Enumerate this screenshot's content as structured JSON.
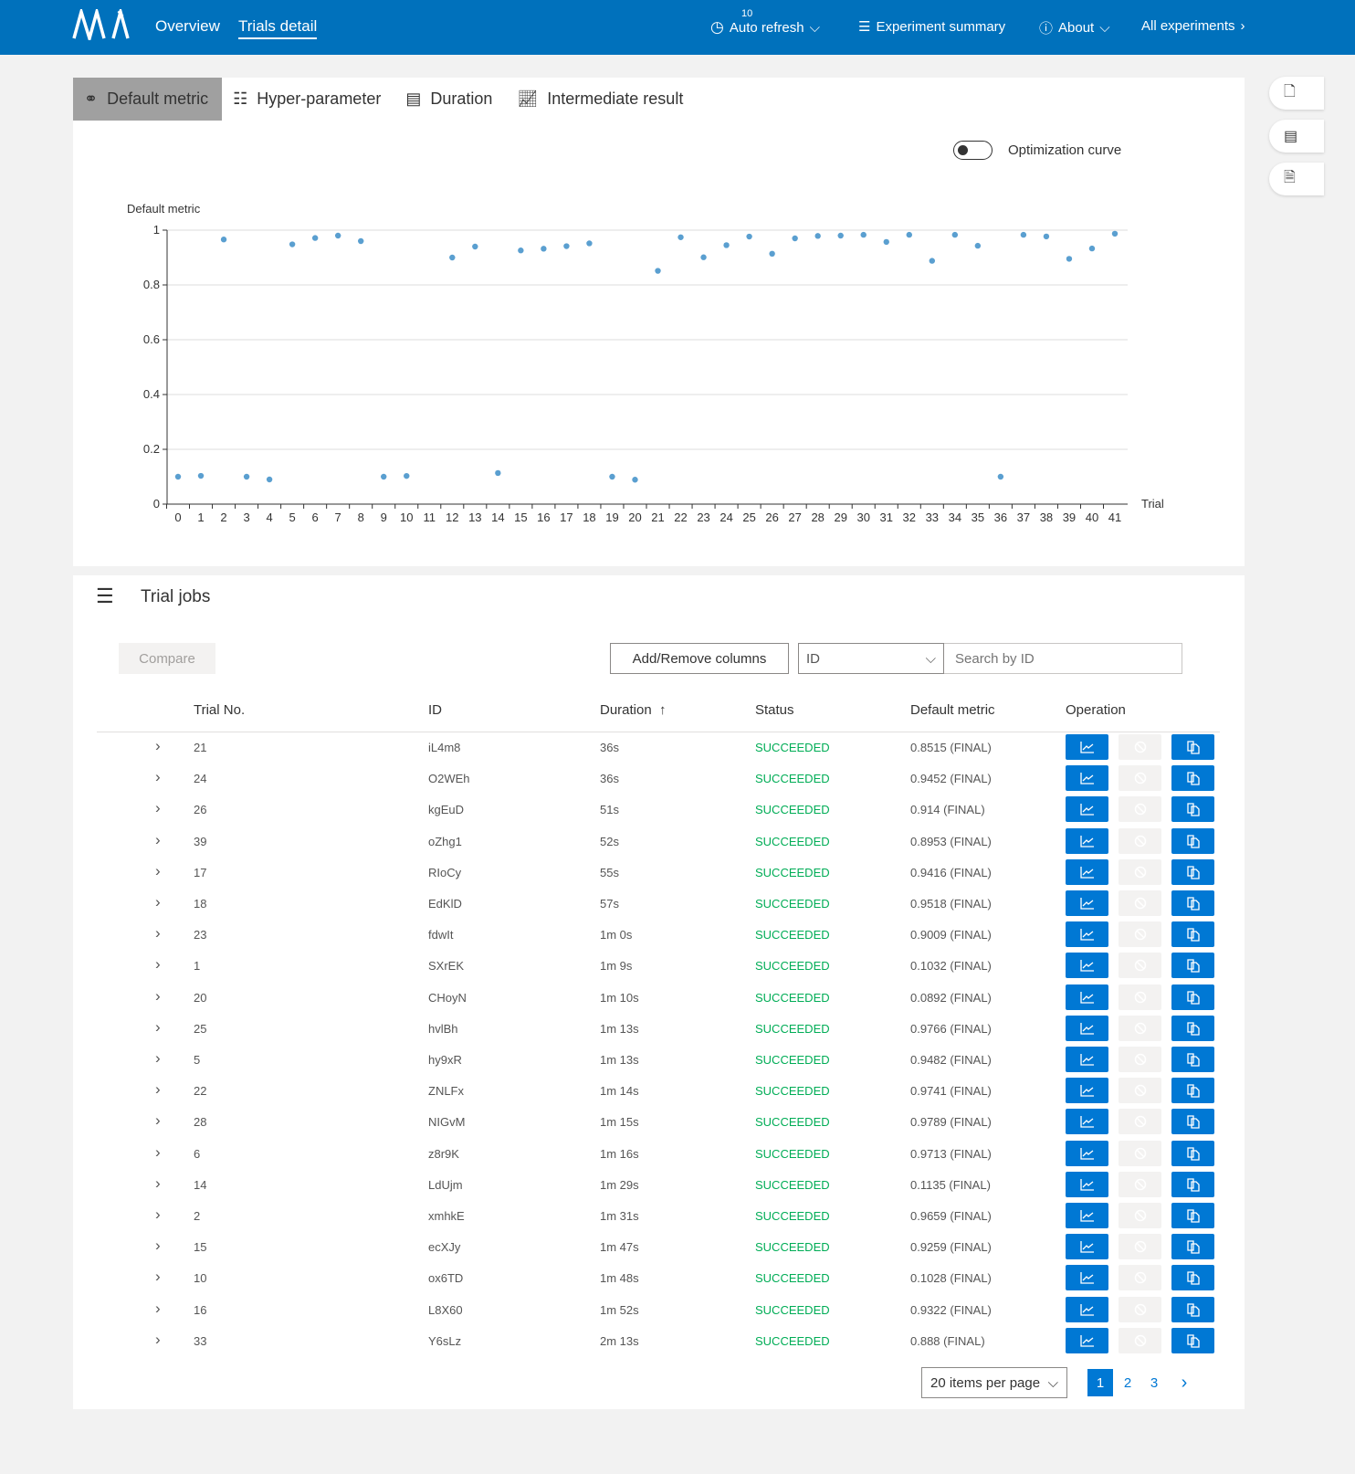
{
  "header": {
    "logo": "NNI",
    "nav": [
      "Overview",
      "Trials detail"
    ],
    "auto_refresh": "Auto refresh",
    "refresh_interval": "10",
    "experiment_summary": "Experiment summary",
    "about": "About",
    "all_experiments": "All experiments"
  },
  "tabs": [
    "Default metric",
    "Hyper-parameter",
    "Duration",
    "Intermediate result"
  ],
  "optimization_curve": "Optimization curve",
  "chart_data": {
    "type": "scatter",
    "ylabel": "Default metric",
    "xlabel": "Trial",
    "ylim": [
      0,
      1
    ],
    "yticks": [
      "0",
      "0.2",
      "0.4",
      "0.6",
      "0.8",
      "1"
    ],
    "xticks": [
      "0",
      "1",
      "2",
      "3",
      "4",
      "5",
      "6",
      "7",
      "8",
      "9",
      "10",
      "11",
      "12",
      "13",
      "14",
      "15",
      "16",
      "17",
      "18",
      "19",
      "20",
      "21",
      "22",
      "23",
      "24",
      "25",
      "26",
      "27",
      "28",
      "29",
      "30",
      "31",
      "32",
      "33",
      "34",
      "35",
      "36",
      "37",
      "38",
      "39",
      "40",
      "41"
    ],
    "grid": true,
    "color": "#5a9fd0",
    "points": [
      [
        0,
        0.1
      ],
      [
        1,
        0.1032
      ],
      [
        2,
        0.9659
      ],
      [
        3,
        0.1
      ],
      [
        4,
        0.09
      ],
      [
        5,
        0.9482
      ],
      [
        6,
        0.9713
      ],
      [
        7,
        0.98
      ],
      [
        8,
        0.96
      ],
      [
        9,
        0.1
      ],
      [
        10,
        0.1028
      ],
      [
        12,
        0.9
      ],
      [
        13,
        0.94
      ],
      [
        14,
        0.1135
      ],
      [
        15,
        0.9259
      ],
      [
        16,
        0.9322
      ],
      [
        17,
        0.9416
      ],
      [
        18,
        0.9518
      ],
      [
        19,
        0.1
      ],
      [
        20,
        0.0892
      ],
      [
        21,
        0.8515
      ],
      [
        22,
        0.9741
      ],
      [
        23,
        0.9009
      ],
      [
        24,
        0.9452
      ],
      [
        25,
        0.9766
      ],
      [
        26,
        0.914
      ],
      [
        27,
        0.97
      ],
      [
        28,
        0.9789
      ],
      [
        29,
        0.98
      ],
      [
        30,
        0.983
      ],
      [
        31,
        0.957
      ],
      [
        32,
        0.983
      ],
      [
        33,
        0.888
      ],
      [
        34,
        0.983
      ],
      [
        35,
        0.943
      ],
      [
        36,
        0.1
      ],
      [
        37,
        0.983
      ],
      [
        38,
        0.977
      ],
      [
        39,
        0.8953
      ],
      [
        40,
        0.933
      ],
      [
        41,
        0.987
      ]
    ]
  },
  "trial_jobs": {
    "title": "Trial jobs",
    "compare": "Compare",
    "add_remove": "Add/Remove columns",
    "filter_select": "ID",
    "search_placeholder": "Search by ID",
    "columns": [
      "Trial No.",
      "ID",
      "Duration",
      "Status",
      "Default metric",
      "Operation"
    ],
    "sort_indicator": "↑",
    "rows": [
      [
        "21",
        "iL4m8",
        "36s",
        "SUCCEEDED",
        "0.8515 (FINAL)"
      ],
      [
        "24",
        "O2WEh",
        "36s",
        "SUCCEEDED",
        "0.9452 (FINAL)"
      ],
      [
        "26",
        "kgEuD",
        "51s",
        "SUCCEEDED",
        "0.914 (FINAL)"
      ],
      [
        "39",
        "oZhg1",
        "52s",
        "SUCCEEDED",
        "0.8953 (FINAL)"
      ],
      [
        "17",
        "RIoCy",
        "55s",
        "SUCCEEDED",
        "0.9416 (FINAL)"
      ],
      [
        "18",
        "EdKlD",
        "57s",
        "SUCCEEDED",
        "0.9518 (FINAL)"
      ],
      [
        "23",
        "fdwIt",
        "1m 0s",
        "SUCCEEDED",
        "0.9009 (FINAL)"
      ],
      [
        "1",
        "SXrEK",
        "1m 9s",
        "SUCCEEDED",
        "0.1032 (FINAL)"
      ],
      [
        "20",
        "CHoyN",
        "1m 10s",
        "SUCCEEDED",
        "0.0892 (FINAL)"
      ],
      [
        "25",
        "hvlBh",
        "1m 13s",
        "SUCCEEDED",
        "0.9766 (FINAL)"
      ],
      [
        "5",
        "hy9xR",
        "1m 13s",
        "SUCCEEDED",
        "0.9482 (FINAL)"
      ],
      [
        "22",
        "ZNLFx",
        "1m 14s",
        "SUCCEEDED",
        "0.9741 (FINAL)"
      ],
      [
        "28",
        "NIGvM",
        "1m 15s",
        "SUCCEEDED",
        "0.9789 (FINAL)"
      ],
      [
        "6",
        "z8r9K",
        "1m 16s",
        "SUCCEEDED",
        "0.9713 (FINAL)"
      ],
      [
        "14",
        "LdUjm",
        "1m 29s",
        "SUCCEEDED",
        "0.1135 (FINAL)"
      ],
      [
        "2",
        "xmhkE",
        "1m 31s",
        "SUCCEEDED",
        "0.9659 (FINAL)"
      ],
      [
        "15",
        "ecXJy",
        "1m 47s",
        "SUCCEEDED",
        "0.9259 (FINAL)"
      ],
      [
        "10",
        "ox6TD",
        "1m 48s",
        "SUCCEEDED",
        "0.1028 (FINAL)"
      ],
      [
        "16",
        "L8X60",
        "1m 52s",
        "SUCCEEDED",
        "0.9322 (FINAL)"
      ],
      [
        "33",
        "Y6sLz",
        "2m 13s",
        "SUCCEEDED",
        "0.888 (FINAL)"
      ]
    ],
    "status_color": "#00ad56",
    "items_per_page": "20 items per page",
    "pages": [
      "1",
      "2",
      "3"
    ],
    "current_page": "1"
  }
}
